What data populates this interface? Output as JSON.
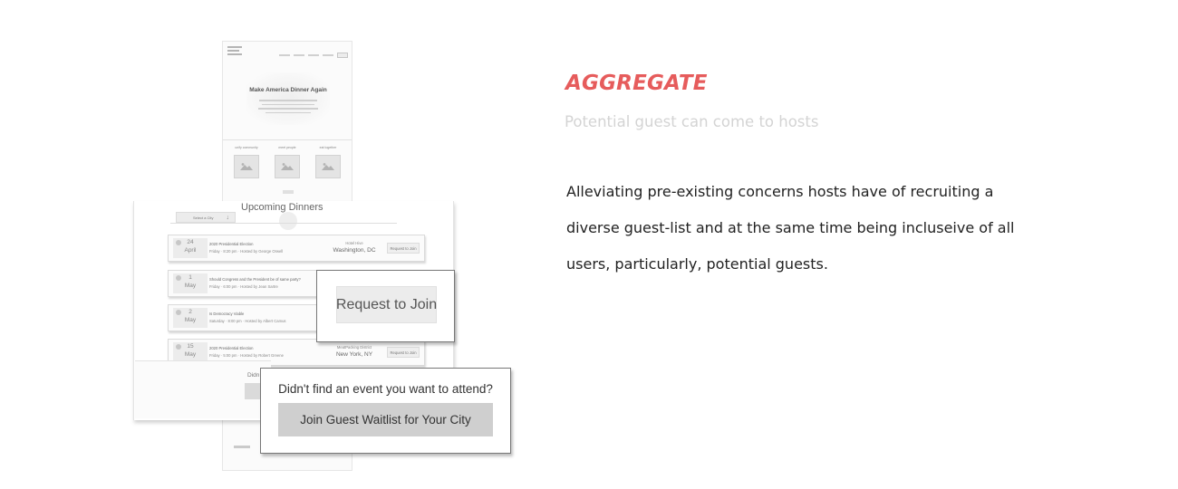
{
  "section": {
    "heading": "AGGREGATE",
    "subheading": "Potential guest can come to hosts",
    "body": "Alleviating pre-existing concerns hosts have of recruiting a diverse guest-list and at the same time being incluseive of all users, particularly, potential guests.",
    "heading_color": "#e65c5c"
  },
  "wireframe": {
    "hero_title": "Make America Dinner Again",
    "columns": [
      "unify community",
      "meet people",
      "eat together"
    ],
    "image_icon": "image-placeholder-icon",
    "upcoming": {
      "title": "Upcoming Dinners",
      "city_select": "Select a City",
      "select_arrow_icon": "arrow-down-icon",
      "events": [
        {
          "day": "24",
          "month": "April",
          "title": "2020 Presidential Election",
          "subtitle": "Friday · 8:20 pm · Hosted by George Orwell",
          "venue": "Hotel Hive",
          "city": "Washington, DC",
          "join": "Request to Join"
        },
        {
          "day": "1",
          "month": "May",
          "title": "Should Congress and the President be of same party?",
          "subtitle": "Friday · 6:00 pm · Hosted by Jean Sartre",
          "venue": "",
          "city": "",
          "join": ""
        },
        {
          "day": "2",
          "month": "May",
          "title": "Is Democracy Viable",
          "subtitle": "Saturday · 8:00 pm · Hosted by Albert Camus",
          "venue": "",
          "city": "",
          "join": ""
        },
        {
          "day": "15",
          "month": "May",
          "title": "2020 Presidential Election",
          "subtitle": "Friday · 5:00 pm · Hosted by Robert Greene",
          "venue": "MeatPacking District",
          "city": "New York, NY",
          "join": "Request to Join"
        }
      ],
      "lower_peek": "Didn"
    },
    "callout_join": "Request to Join",
    "callout_waitlist_question": "Didn't find an event you want to attend?",
    "callout_waitlist_button": "Join Guest Waitlist for Your City"
  }
}
